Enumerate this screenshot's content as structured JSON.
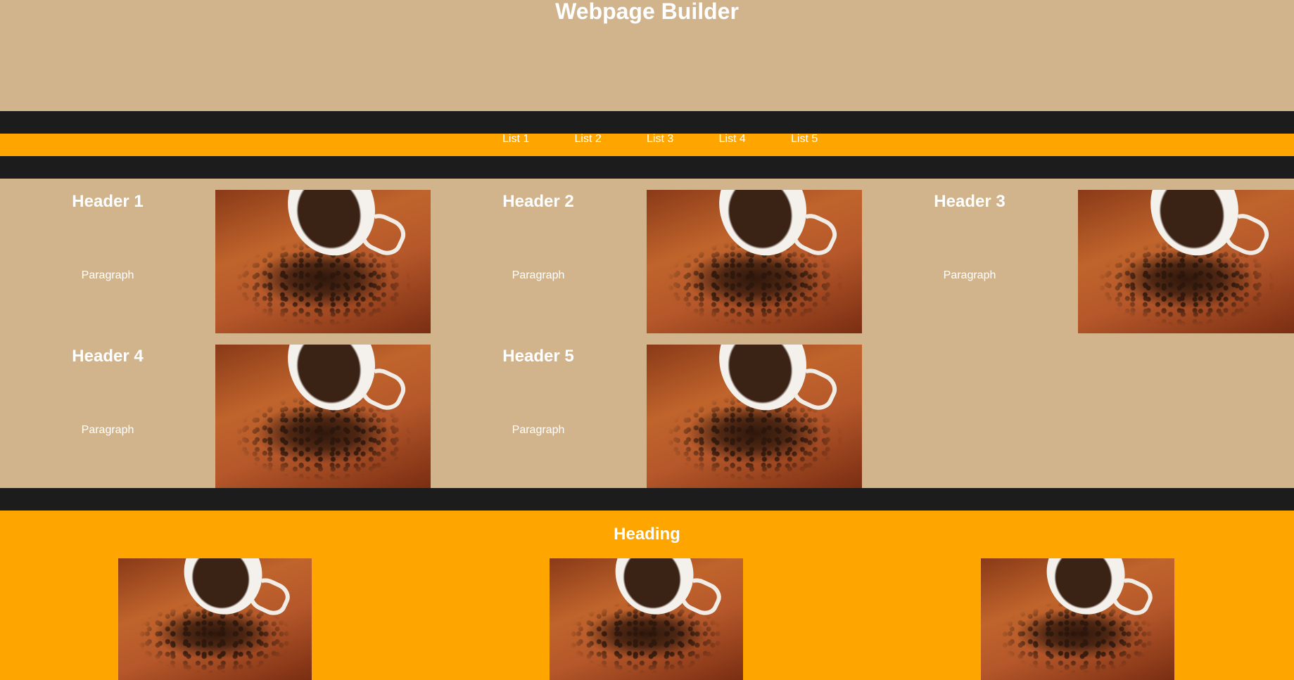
{
  "title": "Webpage Builder",
  "nav": {
    "items": [
      "List 1",
      "List 2",
      "List 3",
      "List 4",
      "List 5"
    ]
  },
  "cards": [
    {
      "header": "Header 1",
      "paragraph": "Paragraph"
    },
    {
      "header": "Header 2",
      "paragraph": "Paragraph"
    },
    {
      "header": "Header 3",
      "paragraph": "Paragraph"
    },
    {
      "header": "Header 4",
      "paragraph": "Paragraph"
    },
    {
      "header": "Header 5",
      "paragraph": "Paragraph"
    }
  ],
  "bottom": {
    "heading": "Heading"
  },
  "colors": {
    "background": "#d2b48c",
    "accent": "#ffa500",
    "dark": "#1c1c1c",
    "text": "#ffffff"
  },
  "icons": {
    "image": "coffee-beans-cup-photo"
  }
}
